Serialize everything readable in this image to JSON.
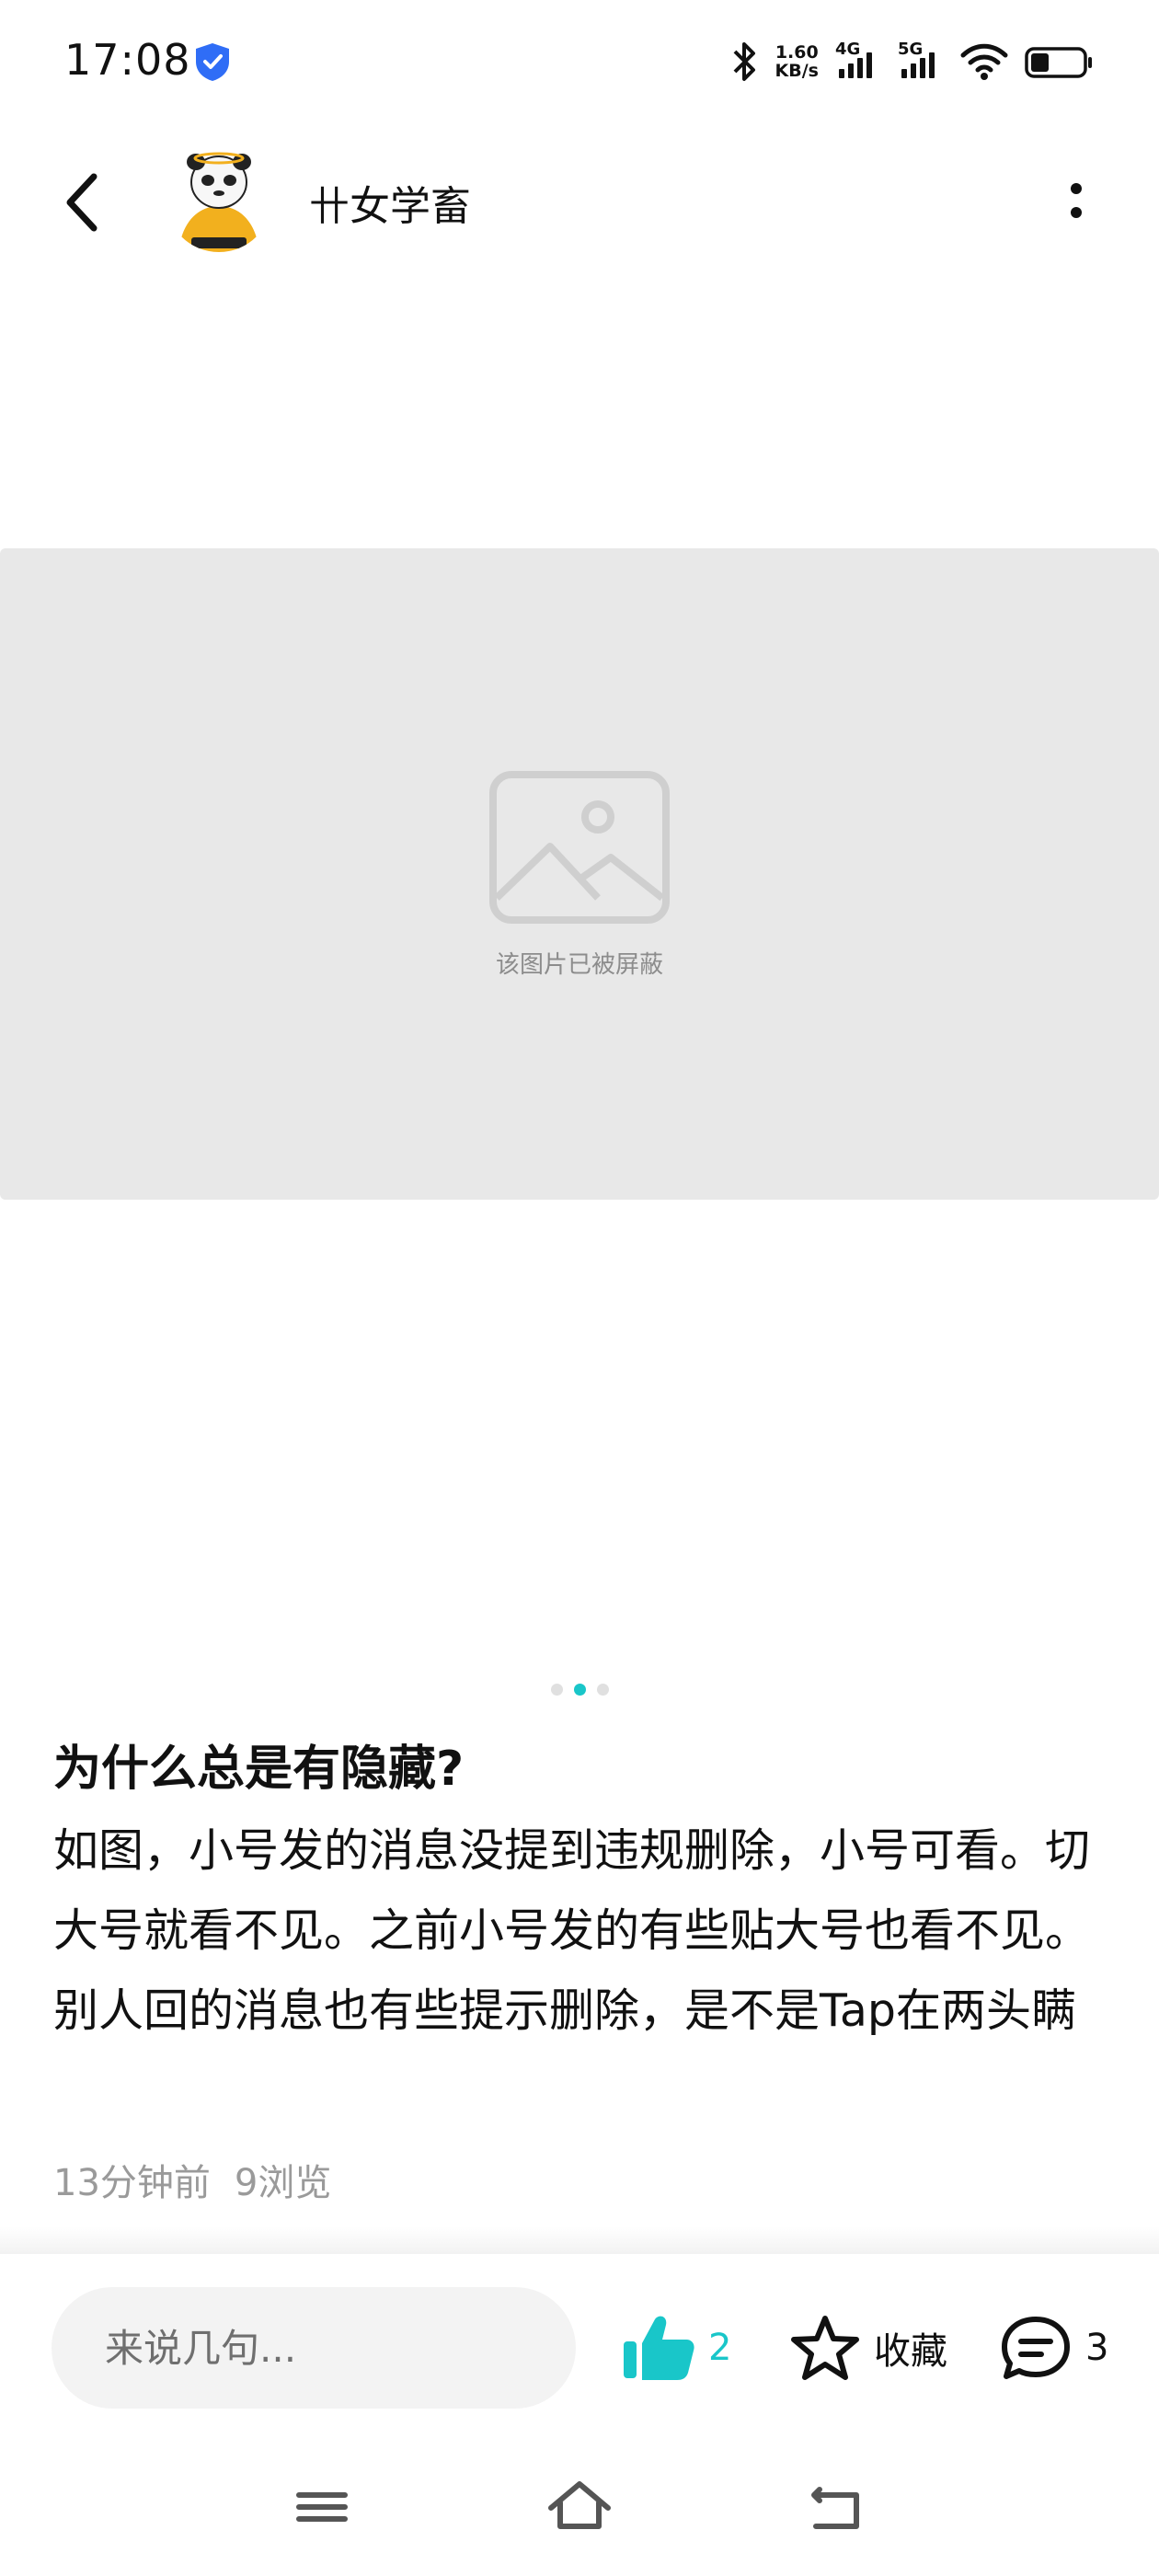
{
  "status_bar": {
    "time": "17:08",
    "net_speed_value": "1.60",
    "net_speed_unit": "KB/s",
    "signal_1": "4G",
    "signal_2": "5G",
    "battery_level": 0.35
  },
  "header": {
    "username": "卄女学畜"
  },
  "image": {
    "blocked_text": "该图片已被屏蔽",
    "carousel_total": 3,
    "carousel_active": 2
  },
  "post": {
    "title": "为什么总是有隐藏?",
    "body": "如图，小号发的消息没提到违规删除，小号可看。切大号就看不见。之前小号发的有些贴大号也看不见。别人回的消息也有些提示删除，是不是Tap在两头瞒",
    "time_ago": "13分钟前",
    "views": "9浏览"
  },
  "bottom_bar": {
    "comment_placeholder": "来说几句...",
    "like_count": "2",
    "favorite_label": "收藏",
    "comment_count": "3"
  },
  "colors": {
    "accent": "#19c6c9",
    "placeholder_bg": "#e8e8e8",
    "muted_text": "#9a9a9a"
  },
  "icons": [
    "shield-icon",
    "bluetooth-icon",
    "wifi-icon",
    "battery-icon",
    "back-arrow-icon",
    "more-vertical-icon",
    "image-placeholder-icon",
    "thumbs-up-icon",
    "star-icon",
    "comment-bubble-icon",
    "menu-icon",
    "home-icon",
    "back-icon"
  ]
}
